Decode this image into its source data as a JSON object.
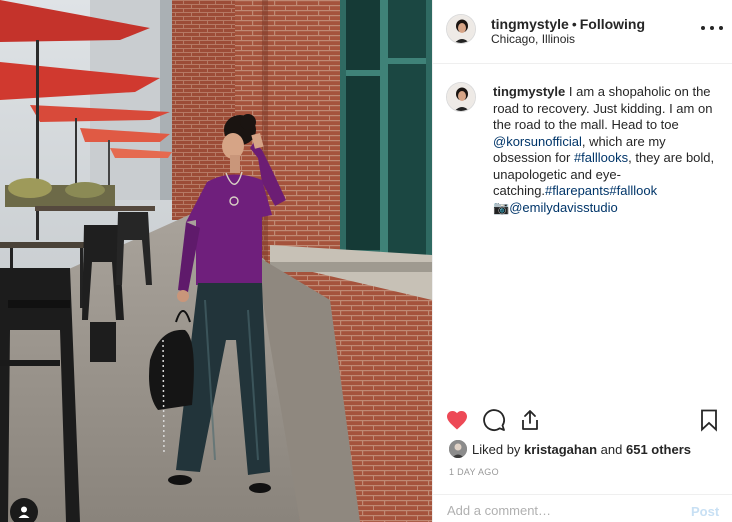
{
  "post": {
    "username": "tingmystyle",
    "separator": "•",
    "follow_status": "Following",
    "location": "Chicago, Illinois",
    "more_icon": "ellipsis-icon"
  },
  "caption": {
    "username": "tingmystyle",
    "text_1": "I am a shopaholic on the road to recovery. Just kidding. I am on the road to the mall. Head to toe ",
    "mention_1": "@korsunofficial",
    "text_2": ", which are my obsession for ",
    "hashtag_1": "#falllooks",
    "text_3": ", they are bold, unapologetic and eye-catching.",
    "hashtag_2": "#flarepants",
    "hashtag_3": "#falllook",
    "camera_emoji": "📷",
    "mention_2": "@emilydavisstudio"
  },
  "actions": {
    "like_icon": "heart-icon",
    "comment_icon": "comment-icon",
    "share_icon": "share-icon",
    "save_icon": "bookmark-icon",
    "like_color": "#ed4956"
  },
  "likes": {
    "prefix": "Liked by",
    "user": "kristagahan",
    "joiner": "and",
    "others": "651 others"
  },
  "timestamp": "1 day ago",
  "comment": {
    "placeholder": "Add a comment…",
    "post_label": "Post"
  }
}
